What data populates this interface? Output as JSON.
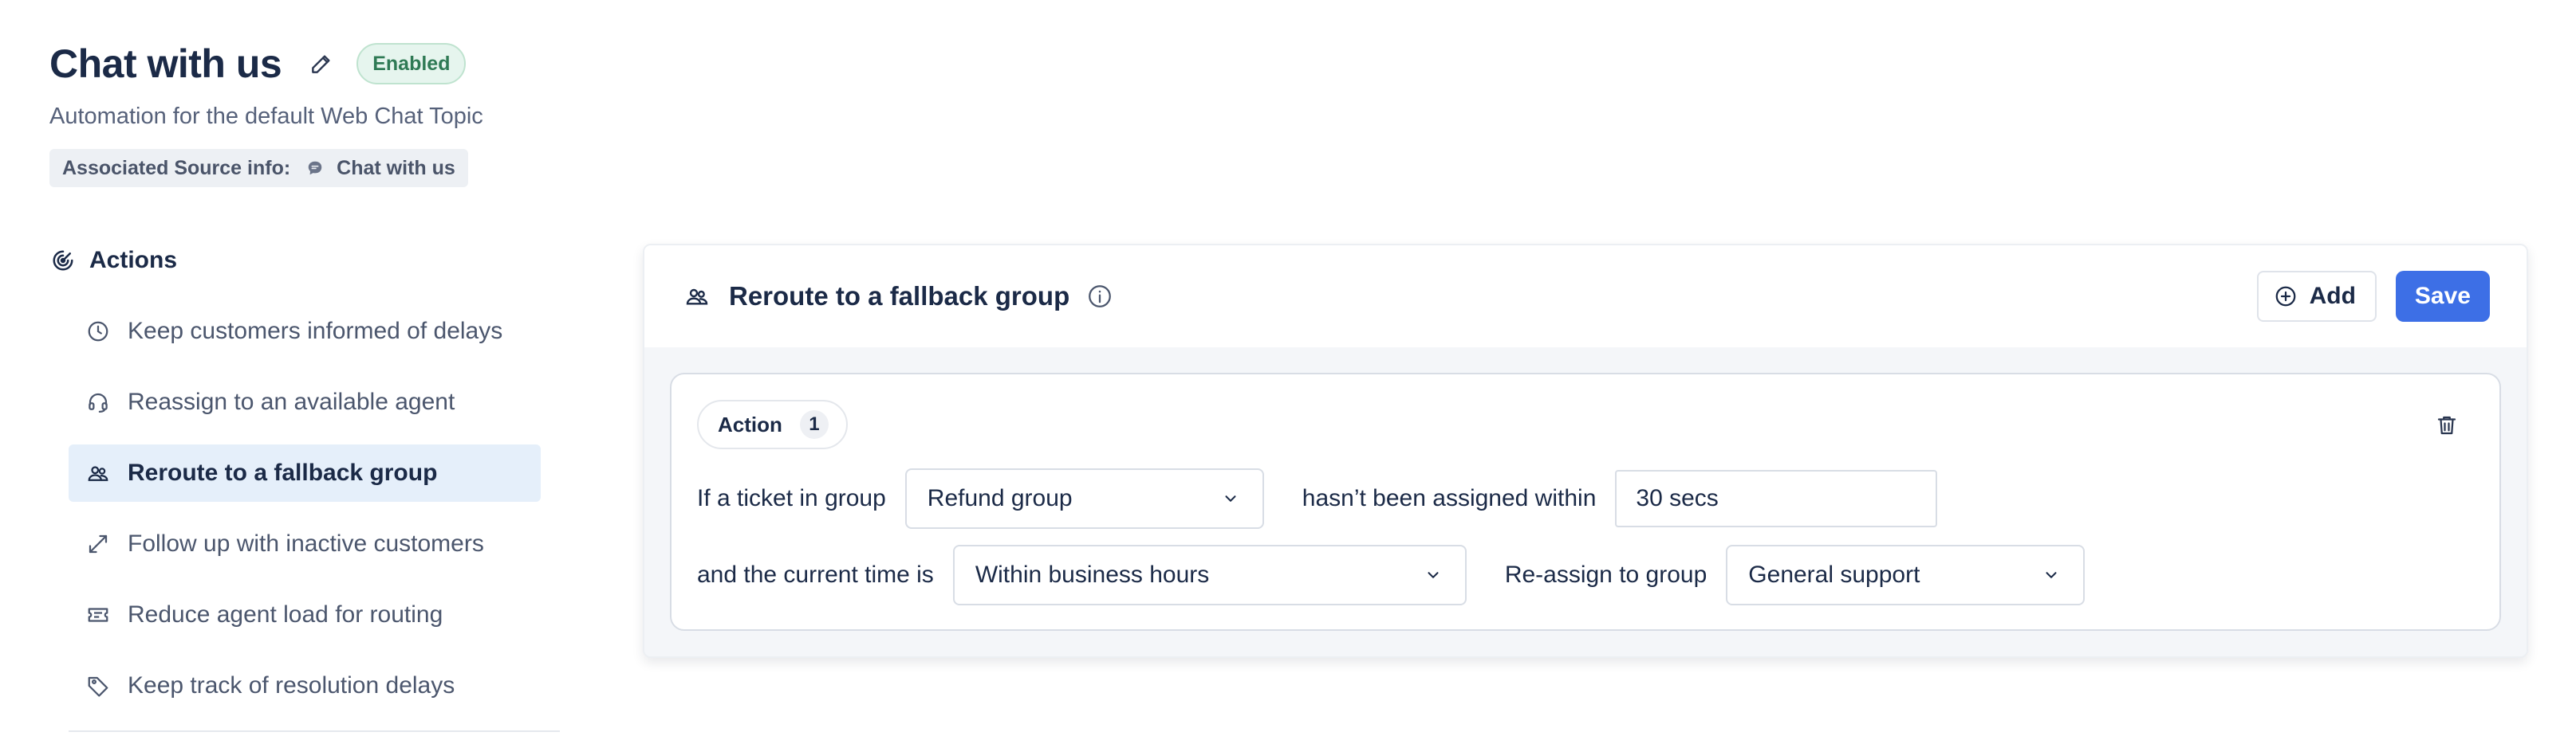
{
  "header": {
    "title": "Chat with us",
    "status": "Enabled",
    "subtitle": "Automation for the default Web Chat Topic",
    "source_label": "Associated Source info:",
    "source_value": "Chat with us"
  },
  "sidebar": {
    "heading": "Actions",
    "items": [
      {
        "label": "Keep customers informed of delays",
        "icon": "clock-icon"
      },
      {
        "label": "Reassign to an available agent",
        "icon": "headset-icon"
      },
      {
        "label": "Reroute to a fallback group",
        "icon": "group-icon",
        "active": true
      },
      {
        "label": "Follow up with inactive customers",
        "icon": "arrows-icon"
      },
      {
        "label": "Reduce agent load for routing",
        "icon": "ticket-icon"
      },
      {
        "label": "Keep track of resolution delays",
        "icon": "tag-icon"
      }
    ]
  },
  "panel": {
    "title": "Reroute to a fallback group",
    "add_label": "Add",
    "save_label": "Save",
    "action_label": "Action",
    "action_count": "1",
    "condition_group_label": "If a ticket in group",
    "condition_group_value": "Refund group",
    "condition_time_label": "hasn’t been assigned within",
    "condition_time_value": "30 secs",
    "current_time_label": "and the current time is",
    "current_time_value": "Within business hours",
    "reassign_label": "Re-assign to group",
    "reassign_value": "General support"
  },
  "colors": {
    "accent": "#3d6fe6",
    "badge_bg": "#e6f5ee",
    "badge_text": "#2f7a55",
    "active_item_bg": "#e5effa"
  }
}
